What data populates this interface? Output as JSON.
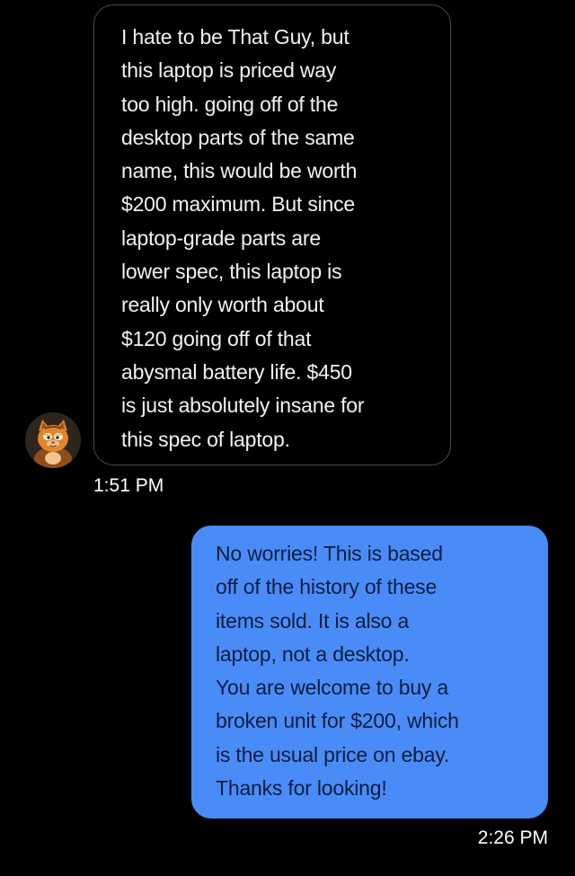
{
  "conversation": {
    "received_message": {
      "text": "I hate to be That Guy, but\nthis laptop is priced way\ntoo high. going off of the\ndesktop parts of the same\nname, this would be worth\n$200 maximum. But since\nlaptop-grade parts are\nlower spec, this laptop is\nreally only worth about\n$120 going off of that\nabysmal battery life. $450\nis just absolutely insane for\nthis spec of laptop.",
      "time": "1:51 PM",
      "avatar_icon": "cartoon-cat-avatar"
    },
    "sent_message": {
      "text": "No worries! This is based\noff of the history of these\nitems sold. It is also a\nlaptop, not a desktop.\nYou are welcome to buy a\nbroken unit for $200, which\nis the usual price on ebay.\nThanks for looking!",
      "time": "2:26 PM"
    }
  },
  "colors": {
    "background": "#000000",
    "received_border": "#4a4a4a",
    "sent_bubble": "#4a8cf7",
    "sent_text": "#0c1d3f"
  }
}
